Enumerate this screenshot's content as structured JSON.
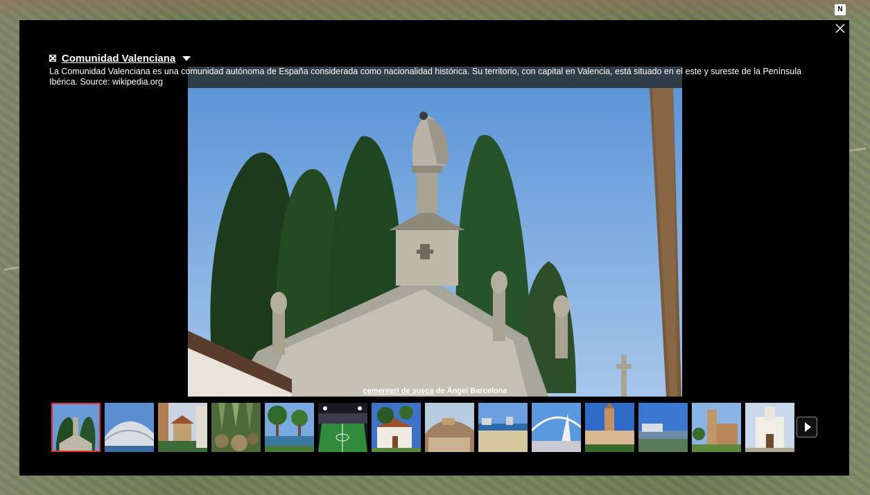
{
  "map": {
    "compass_label": "N"
  },
  "panel": {
    "title": "Comunidad Valenciana",
    "description": "La Comunidad Valenciana es una comunidad autónoma de España considerada como nacionalidad histórica. Su territorio, con capital en Valencia, está situado en el este y sureste de la Península Ibérica. Source: wikipedia.org",
    "photo": {
      "caption_title": "cementeri de sueca",
      "caption_middle": " de ",
      "caption_author": "Ángel Barcelona"
    },
    "thumbnails": [
      {
        "name": "thumb-1-cemetery",
        "selected": true
      },
      {
        "name": "thumb-2-arts-city",
        "selected": false
      },
      {
        "name": "thumb-3-kiosk",
        "selected": false
      },
      {
        "name": "thumb-4-cactus-garden",
        "selected": false
      },
      {
        "name": "thumb-5-palm-garden",
        "selected": false
      },
      {
        "name": "thumb-6-stadium",
        "selected": false
      },
      {
        "name": "thumb-7-church-palms",
        "selected": false
      },
      {
        "name": "thumb-8-town-hill",
        "selected": false
      },
      {
        "name": "thumb-9-beach",
        "selected": false
      },
      {
        "name": "thumb-10-bridge",
        "selected": false
      },
      {
        "name": "thumb-11-tower-square",
        "selected": false
      },
      {
        "name": "thumb-12-seafront",
        "selected": false
      },
      {
        "name": "thumb-13-bell-tower",
        "selected": false
      },
      {
        "name": "thumb-14-white-church",
        "selected": false
      }
    ]
  },
  "icons": {
    "close": "close-icon",
    "next": "chevron-right-icon",
    "dropdown": "caret-down-icon",
    "checkbox": "checkbox-icon"
  },
  "colors": {
    "panel_bg": "#000000",
    "selected_border": "#e0302c",
    "text": "#ffffff"
  }
}
